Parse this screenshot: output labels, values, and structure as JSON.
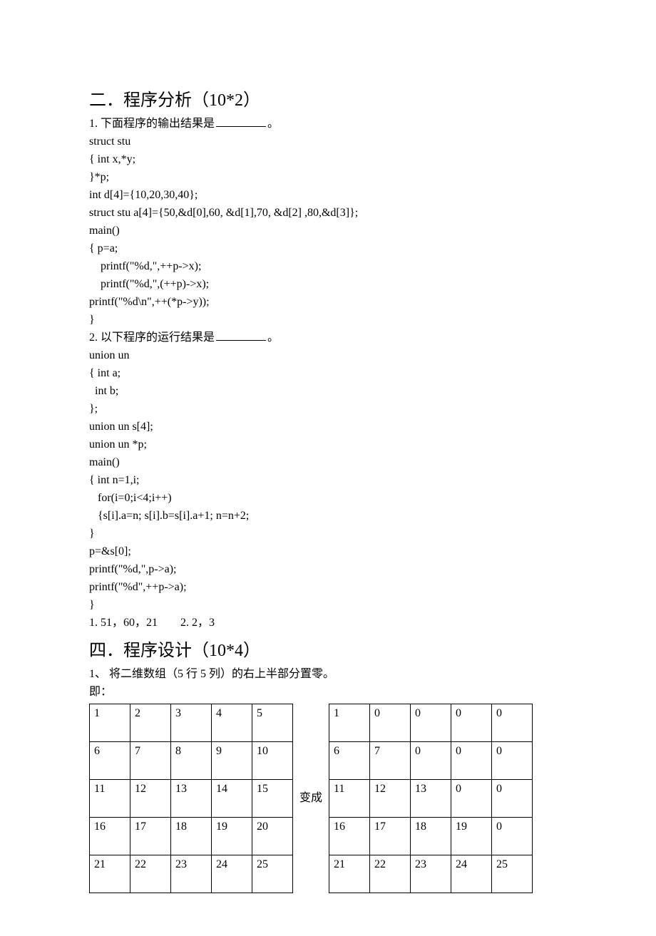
{
  "section2": {
    "title": "二．程序分析（10*2）",
    "q1": {
      "prompt_pre": "1.  下面程序的输出结果是",
      "prompt_post": "。",
      "code": [
        "struct stu",
        "{ int x,*y;",
        "}*p;",
        "int d[4]={10,20,30,40};",
        "struct stu a[4]={50,&d[0],60, &d[1],70, &d[2] ,80,&d[3]};",
        "main()",
        "{ p=a;",
        "    printf(\"%d,\",++p->x);",
        "    printf(\"%d,\",(++p)->x);",
        "printf(\"%d\\n\",++(*p->y));",
        "}"
      ]
    },
    "q2": {
      "prompt_pre": "2.  以下程序的运行结果是",
      "prompt_post": "。",
      "code": [
        "union un",
        "{ int a;",
        "  int b;",
        "};",
        "union un s[4];",
        "union un *p;",
        "main()",
        "{ int n=1,i;",
        "   for(i=0;i<4;i++)",
        "   {s[i].a=n; s[i].b=s[i].a+1; n=n+2;",
        "}",
        "p=&s[0];",
        "printf(\"%d,\",p->a);",
        "printf(\"%d\",++p->a);",
        "}"
      ]
    },
    "answers": "1. 51，60，21        2. 2，3"
  },
  "section4": {
    "title": "四．程序设计（10*4）",
    "q1_line1": "1、 将二维数组（5 行 5 列）的右上半部分置零。",
    "q1_line2": "即：",
    "mid_text": "变成",
    "left_table": [
      [
        "1",
        "2",
        "3",
        "4",
        "5"
      ],
      [
        "6",
        "7",
        "8",
        "9",
        "10"
      ],
      [
        "11",
        "12",
        "13",
        "14",
        "15"
      ],
      [
        "16",
        "17",
        "18",
        "19",
        "20"
      ],
      [
        "21",
        "22",
        "23",
        "24",
        "25"
      ]
    ],
    "right_table": [
      [
        "1",
        "0",
        "0",
        "0",
        "0"
      ],
      [
        "6",
        "7",
        "0",
        "0",
        "0"
      ],
      [
        "11",
        "12",
        "13",
        "0",
        "0"
      ],
      [
        "16",
        "17",
        "18",
        "19",
        "0"
      ],
      [
        "21",
        "22",
        "23",
        "24",
        "25"
      ]
    ]
  }
}
